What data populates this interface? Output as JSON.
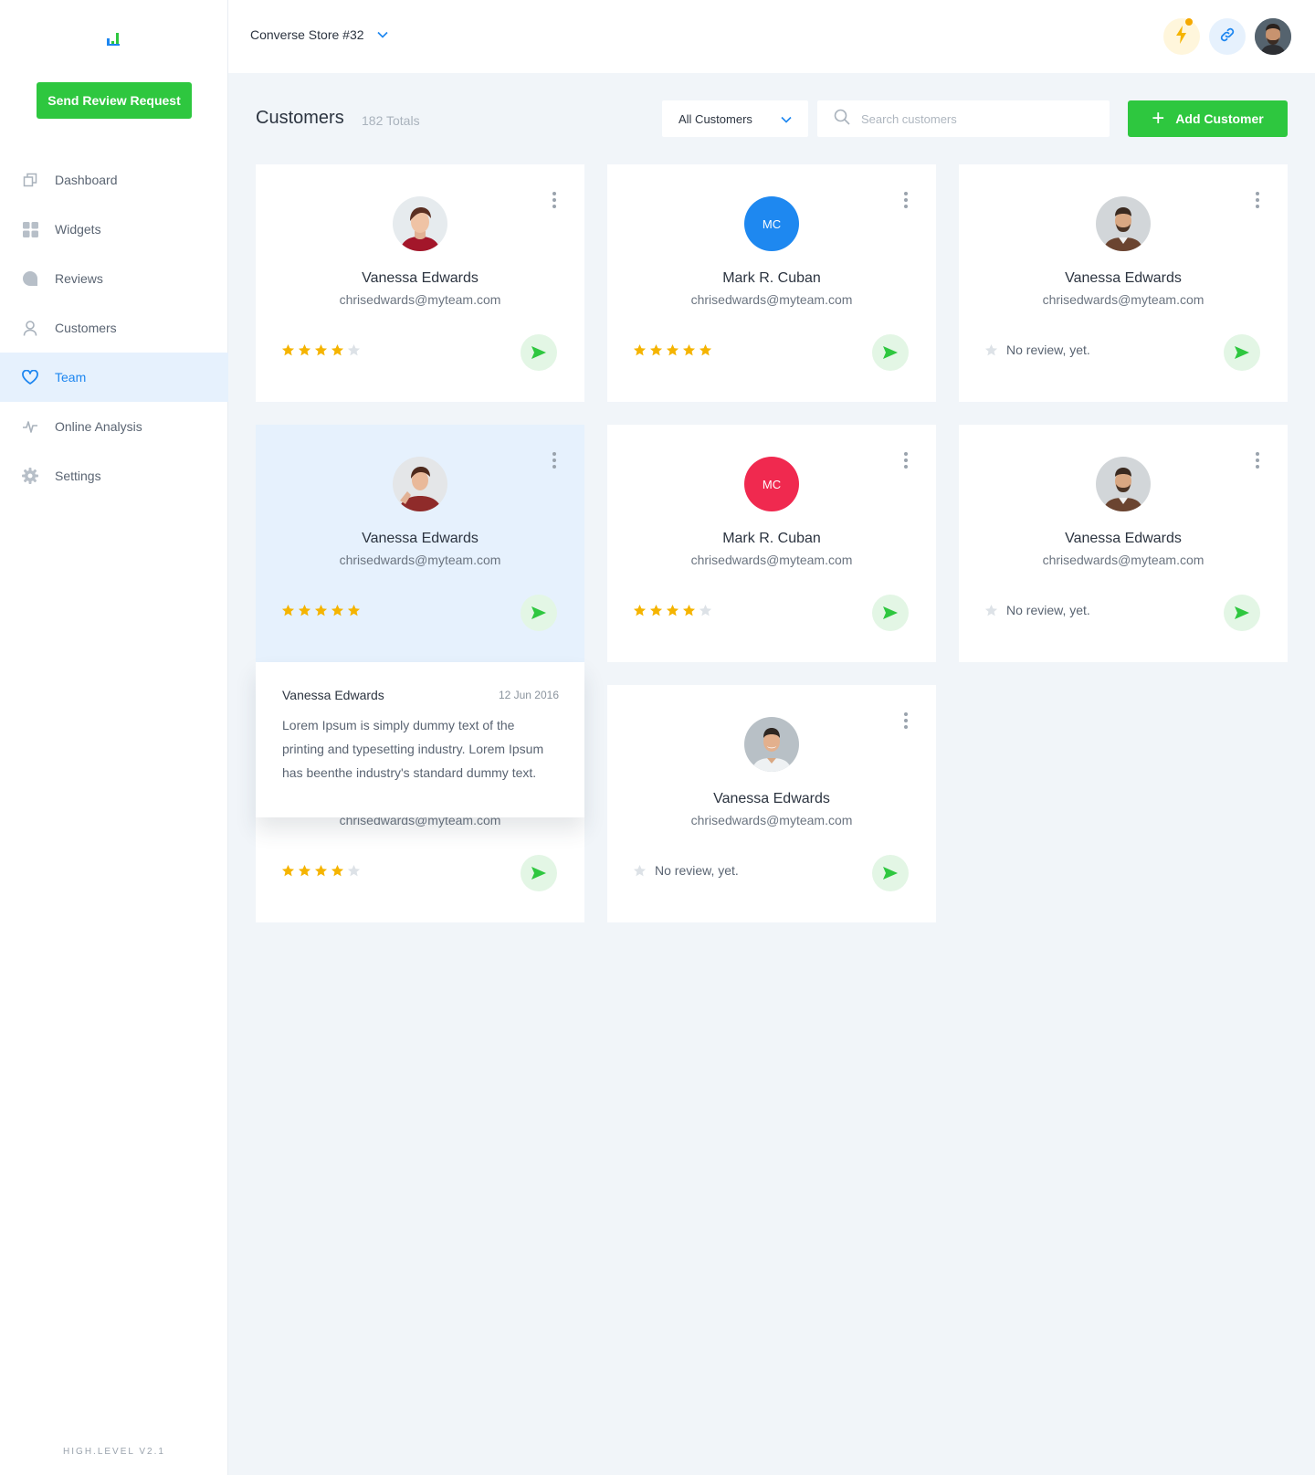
{
  "sidebar": {
    "send_button": "Send Review Request",
    "nav": [
      {
        "label": "Dashboard",
        "icon": "dashboard-icon"
      },
      {
        "label": "Widgets",
        "icon": "widgets-icon"
      },
      {
        "label": "Reviews",
        "icon": "reviews-icon"
      },
      {
        "label": "Customers",
        "icon": "user-icon"
      },
      {
        "label": "Team",
        "icon": "heart-icon",
        "active": true
      },
      {
        "label": "Online Analysis",
        "icon": "pulse-icon"
      },
      {
        "label": "Settings",
        "icon": "gear-icon"
      }
    ],
    "version": "HIGH.LEVEL V2.1"
  },
  "header": {
    "store": "Converse Store #32"
  },
  "toolbar": {
    "title": "Customers",
    "total": "182 Totals",
    "filter": "All Customers",
    "search_placeholder": "Search customers",
    "add_button": "Add Customer"
  },
  "cards": [
    {
      "name": "Vanessa Edwards",
      "email": "chrisedwards@myteam.com",
      "avatar": "photo-woman",
      "rating": 4
    },
    {
      "name": "Mark R. Cuban",
      "email": "chrisedwards@myteam.com",
      "avatar": "initials",
      "initials": "MC",
      "avatar_color": "#1e88f0",
      "rating": 5
    },
    {
      "name": "Vanessa Edwards",
      "email": "chrisedwards@myteam.com",
      "avatar": "photo-man-beard",
      "rating": 0,
      "no_review": "No review, yet."
    },
    {
      "name": "Vanessa Edwards",
      "email": "chrisedwards@myteam.com",
      "avatar": "photo-woman-2",
      "rating": 5,
      "highlight": true
    },
    {
      "name": "Mark R. Cuban",
      "email": "chrisedwards@myteam.com",
      "avatar": "initials",
      "initials": "MC",
      "avatar_color": "#f0294f",
      "rating": 4
    },
    {
      "name": "Vanessa Edwards",
      "email": "chrisedwards@myteam.com",
      "avatar": "photo-man-beard",
      "rating": 0,
      "no_review": "No review, yet."
    },
    {
      "name": "",
      "email": "chrisedwards@myteam.com",
      "avatar": "none",
      "rating": 4
    },
    {
      "name": "Vanessa Edwards",
      "email": "chrisedwards@myteam.com",
      "avatar": "photo-man-smile",
      "rating": 0,
      "no_review": "No review, yet."
    }
  ],
  "popup": {
    "name": "Vanessa Edwards",
    "date": "12 Jun 2016",
    "text": "Lorem Ipsum is simply dummy text of the printing and typesetting industry. Lorem Ipsum has beenthe industry's standard dummy text."
  },
  "colors": {
    "accent_green": "#2ec73f",
    "accent_blue": "#1d86f0",
    "star": "#f5b400",
    "star_empty": "#dde2e7"
  }
}
